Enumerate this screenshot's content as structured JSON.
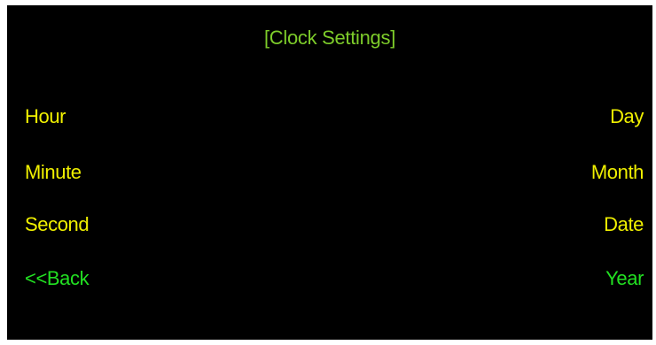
{
  "title": "[Clock Settings]",
  "colors": {
    "background": "#000000",
    "title": "#7dcc2a",
    "item": "#f0f000",
    "item_active": "#22e022"
  },
  "menu": {
    "left": [
      {
        "label": "Hour",
        "state": "normal"
      },
      {
        "label": "Minute",
        "state": "normal"
      },
      {
        "label": "Second",
        "state": "normal"
      },
      {
        "label": "<<Back",
        "state": "active"
      }
    ],
    "right": [
      {
        "label": "Day",
        "state": "normal"
      },
      {
        "label": "Month",
        "state": "normal"
      },
      {
        "label": "Date",
        "state": "normal"
      },
      {
        "label": "Year",
        "state": "active"
      }
    ]
  }
}
